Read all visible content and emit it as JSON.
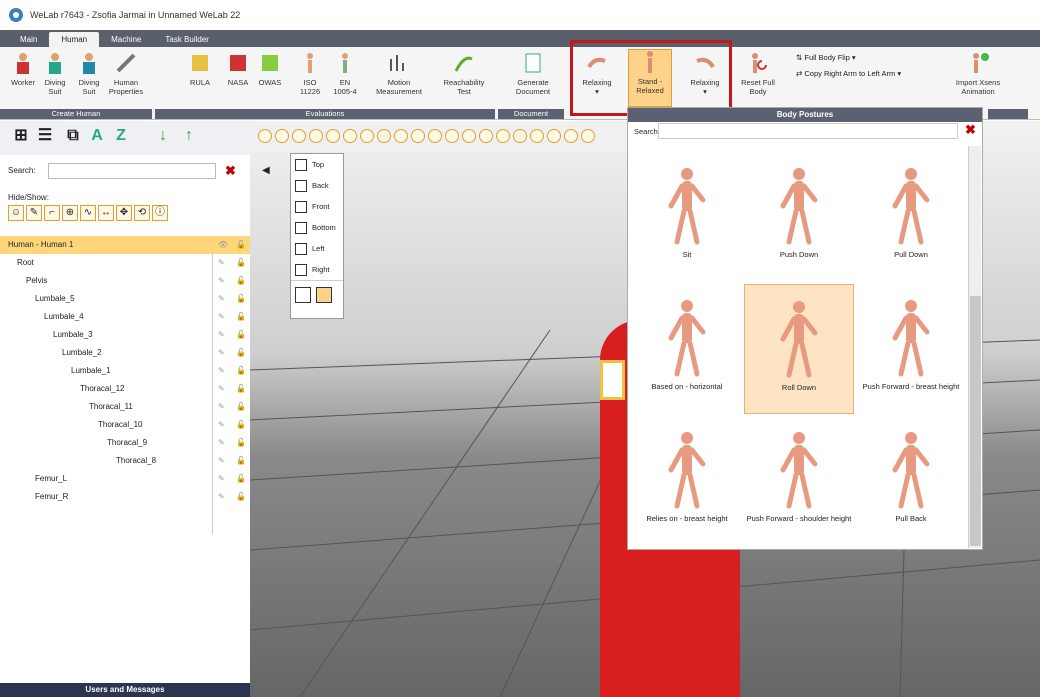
{
  "window": {
    "title": "WeLab r7643 - Zsofia Jarmai in Unnamed WeLab 22"
  },
  "tabs": [
    "Main",
    "Human",
    "Machine",
    "Task Builder"
  ],
  "ribbon": {
    "create_human": {
      "label": "Create Human",
      "buttons": [
        "Worker",
        "Diving Suit",
        "Diving Suit",
        "Human Properties"
      ]
    },
    "evaluations": {
      "label": "Evaluations",
      "buttons": [
        "RULA",
        "NASA",
        "OWAS",
        "ISO 11226",
        "EN 1005-4",
        "Motion Measurement",
        "Reachability Test"
      ]
    },
    "document": {
      "label": "Document",
      "buttons": [
        "Generate Document"
      ]
    },
    "postures": {
      "buttons": [
        "Relaxing",
        "Stand - Relaxed",
        "Relaxing"
      ]
    },
    "reset": {
      "label": "Reset Full Body"
    },
    "flip": {
      "full_body_flip": "Full Body Flip",
      "copy_arm": "Copy Right Arm to Left Arm"
    },
    "import": {
      "label": "Import Xsens Animation"
    }
  },
  "left_panel": {
    "search_label": "Search:",
    "hide_show_label": "Hide/Show:",
    "tree": [
      {
        "label": "Human - Human 1",
        "depth": 0
      },
      {
        "label": "Root",
        "depth": 1
      },
      {
        "label": "Pelvis",
        "depth": 2
      },
      {
        "label": "Lumbale_5",
        "depth": 3
      },
      {
        "label": "Lumbale_4",
        "depth": 4
      },
      {
        "label": "Lumbale_3",
        "depth": 5
      },
      {
        "label": "Lumbale_2",
        "depth": 6
      },
      {
        "label": "Lumbale_1",
        "depth": 7
      },
      {
        "label": "Thoracal_12",
        "depth": 8
      },
      {
        "label": "Thoracal_11",
        "depth": 9
      },
      {
        "label": "Thoracal_10",
        "depth": 10
      },
      {
        "label": "Thoracal_9",
        "depth": 11
      },
      {
        "label": "Thoracal_8",
        "depth": 12
      },
      {
        "label": "Femur_L",
        "depth": 3
      },
      {
        "label": "Femur_R",
        "depth": 3
      }
    ],
    "users_bar": "Users and Messages"
  },
  "view_menu": [
    "Top",
    "Back",
    "Front",
    "Bottom",
    "Left",
    "Right"
  ],
  "postures_dropdown": {
    "header": "Body Postures",
    "search_label": "Search:",
    "items": [
      {
        "label": "Sit",
        "selected": false
      },
      {
        "label": "Push Down",
        "selected": false
      },
      {
        "label": "Pull Down",
        "selected": false
      },
      {
        "label": "Based on - horizontal",
        "selected": false
      },
      {
        "label": "Roll Down",
        "selected": true
      },
      {
        "label": "Push Forward - breast height",
        "selected": false
      },
      {
        "label": "Relies on - breast height",
        "selected": false
      },
      {
        "label": "Push Forward - shoulder height",
        "selected": false
      },
      {
        "label": "Pull Back",
        "selected": false
      }
    ]
  },
  "colors": {
    "accent": "#ffd28a",
    "redbox": "#c4161c",
    "header": "#5b6170"
  }
}
